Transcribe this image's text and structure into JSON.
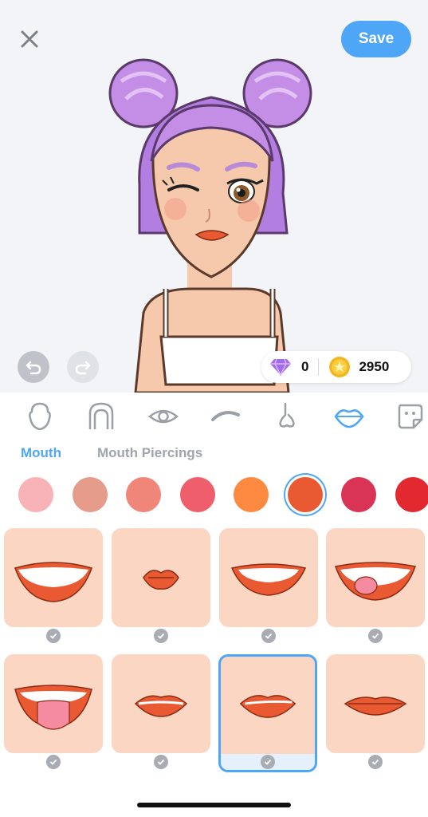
{
  "header": {
    "save_label": "Save"
  },
  "wallet": {
    "gems": "0",
    "coins": "2950"
  },
  "categories": [
    "face-shape-icon",
    "hair-icon",
    "eye-icon",
    "eyebrow-icon",
    "nose-icon",
    "lips-icon",
    "sticker-icon"
  ],
  "active_category": "lips-icon",
  "subtabs": [
    {
      "label": "Mouth",
      "active": true
    },
    {
      "label": "Mouth Piercings",
      "active": false
    }
  ],
  "colors": [
    "#f7b3b8",
    "#e59c8b",
    "#f0867a",
    "#ee5f6b",
    "#fd8a40",
    "#ea5a32",
    "#d93356",
    "#e1292f"
  ],
  "selected_color_index": 5,
  "mouth_options": [
    {
      "style": "big-smile",
      "selected": false
    },
    {
      "style": "kiss",
      "selected": false
    },
    {
      "style": "smile",
      "selected": false
    },
    {
      "style": "tongue-side",
      "selected": false
    },
    {
      "style": "tongue-out",
      "selected": false
    },
    {
      "style": "neutral",
      "selected": false
    },
    {
      "style": "smirk",
      "selected": true
    },
    {
      "style": "flat",
      "selected": false
    }
  ],
  "theme": {
    "accent": "#4ea6f7",
    "card_bg": "#fbd6c2",
    "lip_color": "#ea5a32"
  }
}
